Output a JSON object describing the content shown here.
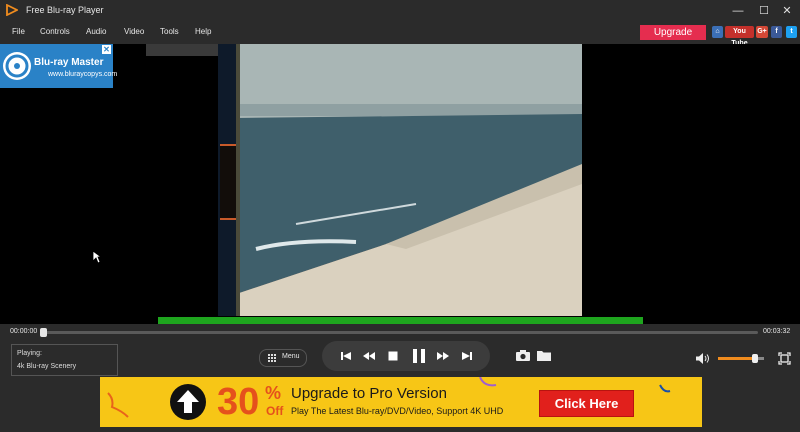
{
  "app": {
    "title": "Free Blu-ray Player"
  },
  "menu": {
    "items": [
      "File",
      "Controls",
      "Audio",
      "Video",
      "Tools",
      "Help"
    ]
  },
  "header": {
    "upgrade_label": "Upgrade",
    "social": [
      {
        "name": "home-icon",
        "text": ""
      },
      {
        "name": "youtube-icon",
        "text": "You Tube"
      },
      {
        "name": "google-plus-icon",
        "text": "G+"
      },
      {
        "name": "facebook-icon",
        "text": "f"
      },
      {
        "name": "twitter-icon",
        "text": ""
      }
    ]
  },
  "brand": {
    "name": "Blu-ray Master",
    "url": "www.bluraycopys.com"
  },
  "playback": {
    "current_time": "00:00:00",
    "duration": "00:03:32",
    "progress": 0.0,
    "volume": 0.8
  },
  "now_playing": {
    "label": "Playing:",
    "title": "4k Blu-ray Scenery"
  },
  "controls": {
    "menu_label": "Menu"
  },
  "ad": {
    "percent": "30",
    "percent_sign": "%",
    "off": "Off",
    "title": "Upgrade to Pro Version",
    "subtitle": "Play The Latest Blu-ray/DVD/Video, Support 4K UHD",
    "cta": "Click Here"
  },
  "colors": {
    "accent": "#f08c1e",
    "upgrade": "#e52d4f",
    "seek_complete": "#1ea51e",
    "ad_bg": "#f7c616"
  }
}
